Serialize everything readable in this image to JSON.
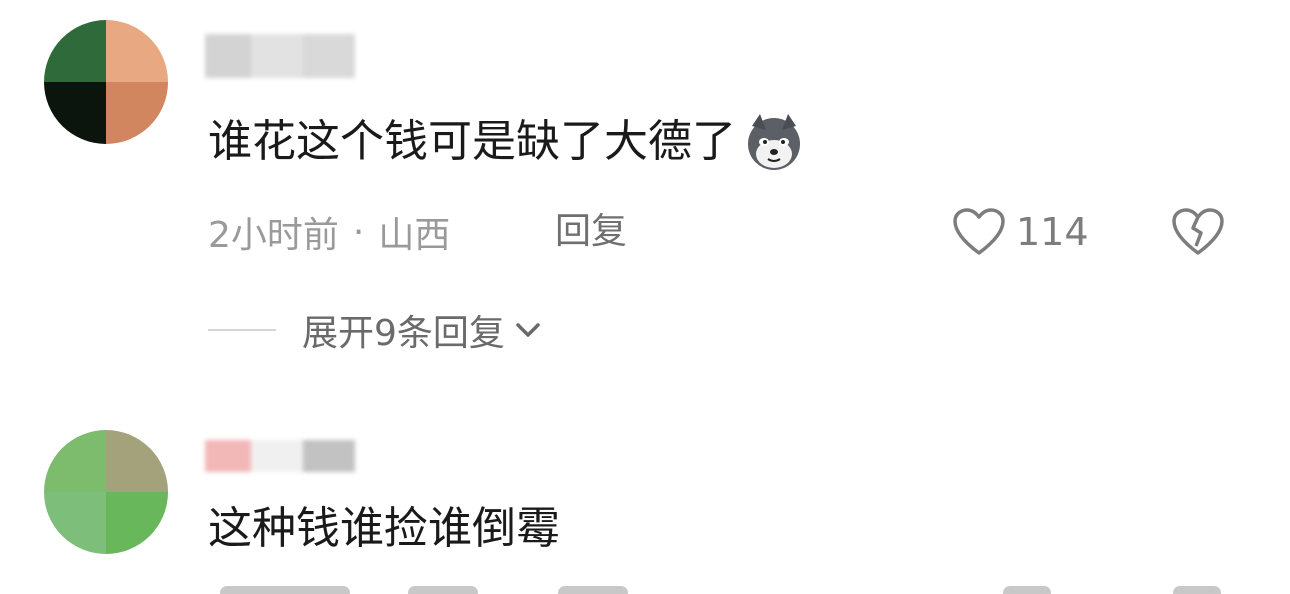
{
  "comments": [
    {
      "text": "谁花这个钱可是缺了大德了",
      "time": "2小时前",
      "separator": "·",
      "location": "山西",
      "reply_label": "回复",
      "like_count": "114",
      "expand_label": "展开9条回复",
      "emoji": "husky-emoji-icon"
    },
    {
      "text": "这种钱谁捡谁倒霉"
    }
  ],
  "colors": {
    "text": "#1a1a1a",
    "meta": "#9a9a9a",
    "icon": "#7d7d7d",
    "background": "#ffffff"
  }
}
